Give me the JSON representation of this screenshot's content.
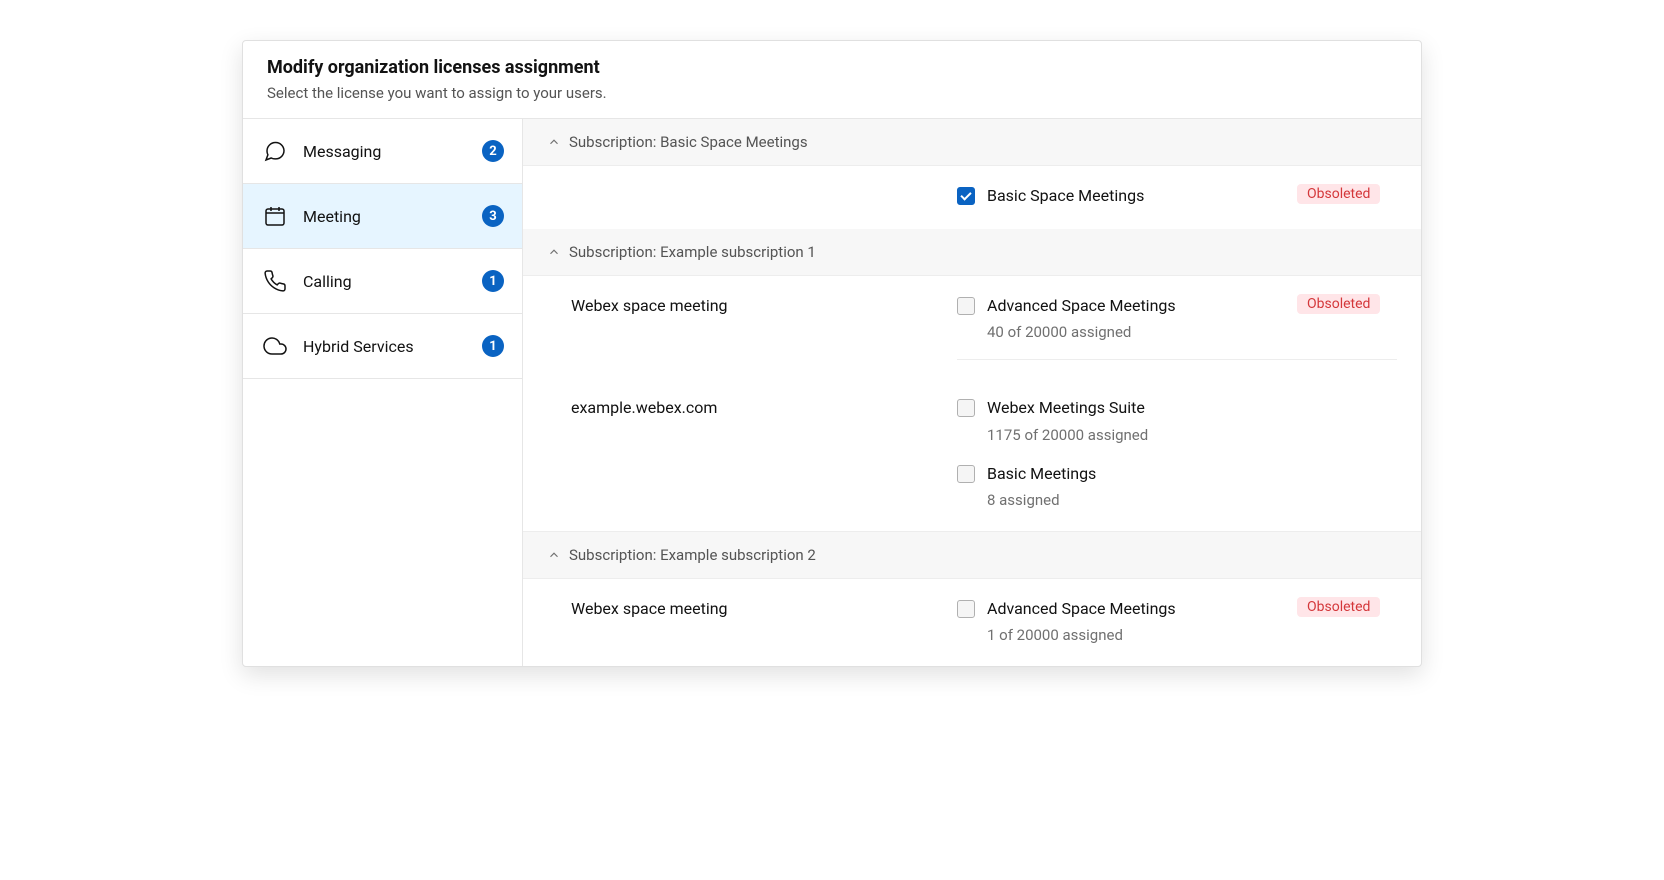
{
  "header": {
    "title": "Modify organization licenses assignment",
    "subtitle": "Select the license you want to assign to your users."
  },
  "sidebar": {
    "items": [
      {
        "label": "Messaging",
        "count": "2"
      },
      {
        "label": "Meeting",
        "count": "3"
      },
      {
        "label": "Calling",
        "count": "1"
      },
      {
        "label": "Hybrid Services",
        "count": "1"
      }
    ]
  },
  "badges": {
    "obsoleted": "Obsoleted"
  },
  "subscriptions": [
    {
      "title": "Subscription: Basic Space Meetings",
      "rows": [
        {
          "left": "",
          "options": [
            {
              "name": "Basic Space Meetings",
              "sub": "",
              "checked": true,
              "obsoleted": true
            }
          ]
        }
      ]
    },
    {
      "title": "Subscription: Example subscription 1",
      "rows": [
        {
          "left": "Webex space meeting",
          "options": [
            {
              "name": "Advanced Space Meetings",
              "sub": "40 of 20000 assigned",
              "checked": false,
              "obsoleted": true
            }
          ]
        },
        {
          "left": "example.webex.com",
          "options": [
            {
              "name": "Webex Meetings Suite",
              "sub": "1175 of 20000 assigned",
              "checked": false,
              "obsoleted": false
            },
            {
              "name": "Basic Meetings",
              "sub": "8 assigned",
              "checked": false,
              "obsoleted": false
            }
          ]
        }
      ]
    },
    {
      "title": "Subscription: Example subscription 2",
      "rows": [
        {
          "left": "Webex space meeting",
          "options": [
            {
              "name": "Advanced Space Meetings",
              "sub": "1 of 20000 assigned",
              "checked": false,
              "obsoleted": true
            }
          ]
        }
      ]
    }
  ]
}
